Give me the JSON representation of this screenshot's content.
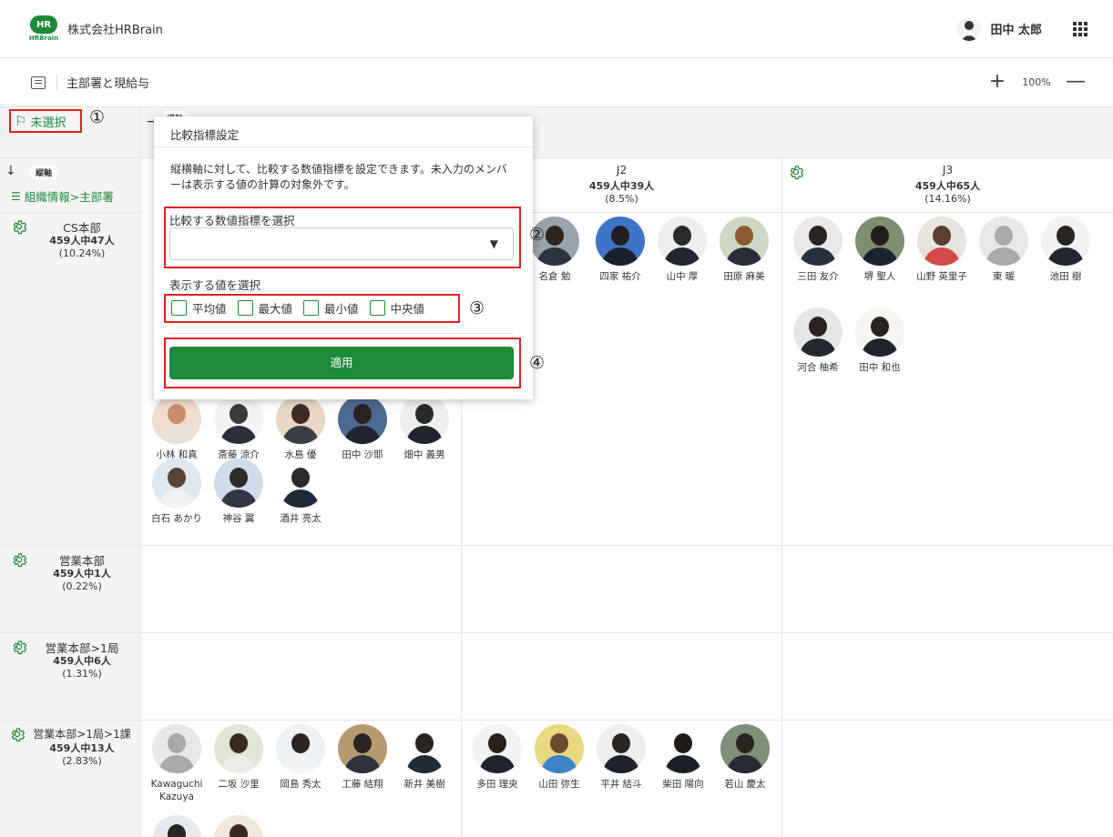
{
  "header": {
    "logo_mark": "HR",
    "logo_text": "HRBrain",
    "company": "株式会社HRBrain",
    "user_name": "田中 太郎"
  },
  "toolbar": {
    "title": "主部署と現給与",
    "zoom": "100%",
    "zoom_in": "+",
    "zoom_out": "—"
  },
  "grid": {
    "unselected_label": "未選択",
    "horizontal_badge": "横軸",
    "vertical_badge": "縦軸",
    "vertical_axis": "組織情報>主部署",
    "columns": [
      {
        "title": "J2",
        "count": "459人中39人",
        "pct": "(8.5%)"
      },
      {
        "title": "J3",
        "count": "459人中65人",
        "pct": "(14.16%)"
      }
    ],
    "rows": [
      {
        "title": "CS本部",
        "count": "459人中47人",
        "pct": "(10.24%)"
      },
      {
        "title": "営業本部",
        "count": "459人中1人",
        "pct": "(0.22%)"
      },
      {
        "title": "営業本部>1局",
        "count": "459人中6人",
        "pct": "(1.31%)"
      },
      {
        "title": "営業本部>1局>1課",
        "count": "459人中13人",
        "pct": "(2.83%)"
      }
    ]
  },
  "members": {
    "cs_col1": [
      "小林 和真",
      "斎藤 涼介",
      "水島 優",
      "田中 沙耶",
      "畑中 義男",
      "白石 あかり",
      "神谷 翼",
      "酒井 亮太"
    ],
    "cs_col2": [
      "名倉 勉",
      "四家 祐介",
      "山中 厚",
      "田原 麻美"
    ],
    "cs_col3": [
      "三田 友介",
      "堺 聖人",
      "山野 英里子",
      "東 暖",
      "池田 樹",
      "河合 柚希",
      "田中 和也"
    ],
    "sales_col1": [
      "Kawaguchi Kazuya",
      "二坂 沙里",
      "岡島 秀太",
      "工藤 結翔",
      "新井 美樹"
    ],
    "sales_col2": [
      "多田 理央",
      "山田 弥生",
      "平井 結斗",
      "柴田 陽向",
      "若山 慶太"
    ]
  },
  "popup": {
    "title": "比較指標設定",
    "description": "縦横軸に対して、比較する数値指標を設定できます。未入力のメンバーは表示する値の計算の対象外です。",
    "select_label": "比較する数値指標を選択",
    "select_value": "",
    "show_label": "表示する値を選択",
    "options": [
      "平均値",
      "最大値",
      "最小値",
      "中央値"
    ],
    "apply": "適用"
  },
  "annotations": [
    "①",
    "②",
    "③",
    "④"
  ]
}
